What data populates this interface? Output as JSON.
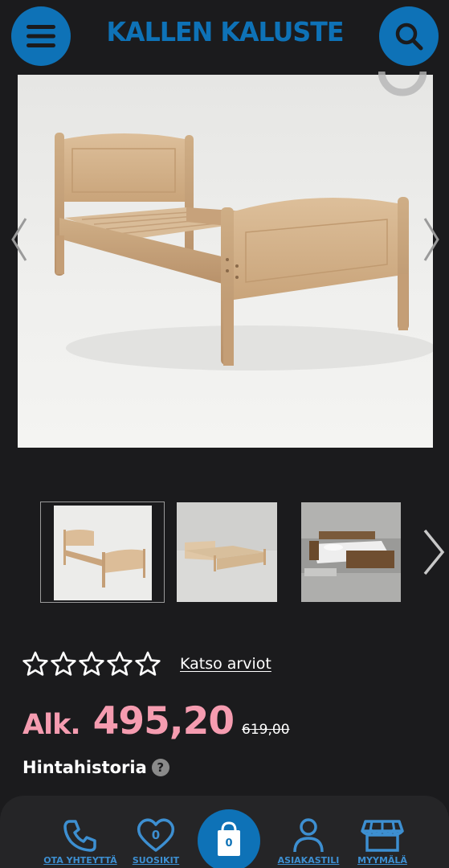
{
  "header": {
    "logo_text": "KALLEN KALUSTE",
    "menu_icon": "hamburger-menu-icon",
    "search_icon": "search-icon",
    "brand_color": "#0e72b7"
  },
  "gallery": {
    "main_image_alt": "Puinen sänky",
    "prev_icon": "chevron-left-icon",
    "next_icon": "chevron-right-icon",
    "thumbnail_count": 3
  },
  "rating": {
    "stars_filled": 0,
    "stars_total": 5,
    "reviews_link": "Katso arviot"
  },
  "price": {
    "prefix": "Alk.",
    "current": "495,20",
    "original": "619,00",
    "color": "#f59cb0"
  },
  "price_history": {
    "label": "Hintahistoria",
    "help_symbol": "?"
  },
  "bottom_nav": {
    "contact_label": "OTA YHTEYTTÄ",
    "favorites_label": "SUOSIKIT",
    "favorites_count": "0",
    "cart_count": "0",
    "account_label": "ASIAKASTILI",
    "store_label": "MYYMÄLÄ",
    "accent_color": "#3d8fd1"
  }
}
